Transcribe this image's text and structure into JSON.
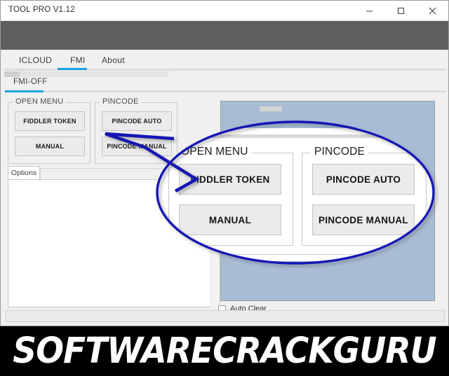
{
  "window": {
    "title": "TOOL PRO V1.12",
    "controls": [
      {
        "name": "minimize-button",
        "glyph": "minimize"
      },
      {
        "name": "maximize-button",
        "glyph": "maximize"
      },
      {
        "name": "close-button",
        "glyph": "close"
      }
    ]
  },
  "tabs": [
    {
      "label": "ICLOUD",
      "active": false
    },
    {
      "label": "FMI",
      "active": true
    },
    {
      "label": "About",
      "active": false
    }
  ],
  "subtab": {
    "label": "FMI-OFF",
    "active": true
  },
  "groups": [
    {
      "legend": "OPEN MENU",
      "buttons": [
        {
          "label": "FIDDLER TOKEN"
        },
        {
          "label": "MANUAL"
        }
      ]
    },
    {
      "legend": "PINCODE",
      "buttons": [
        {
          "label": "PINCODE AUTO"
        },
        {
          "label": "PINCODE MANUAL"
        }
      ]
    }
  ],
  "options": {
    "tab_label": "Options",
    "log_text": ""
  },
  "auto_clear": {
    "label": "Auto Clear",
    "checked": false
  },
  "magnifier": {
    "outline_color": "#1419b4",
    "subtab": {
      "label": "FMI-OFF"
    },
    "groups": [
      {
        "legend": "OPEN MENU",
        "buttons": [
          {
            "label": "FIDDLER TOKEN"
          },
          {
            "label": "MANUAL"
          }
        ]
      },
      {
        "legend": "PINCODE",
        "buttons": [
          {
            "label": "PINCODE AUTO"
          },
          {
            "label": "PINCODE MANUAL"
          }
        ]
      }
    ],
    "options_tab_label": "Options"
  },
  "banner": {
    "text": "SOFTWARECRACKGURU"
  },
  "colors": {
    "accent_blue": "#1aa3e0",
    "panel_bluegray": "#a8bcd6",
    "titlebar_band": "#5e5e5e",
    "bubble_outline": "#1419b4",
    "window_bg": "#f0f0f0",
    "banner_bg": "#000000"
  }
}
